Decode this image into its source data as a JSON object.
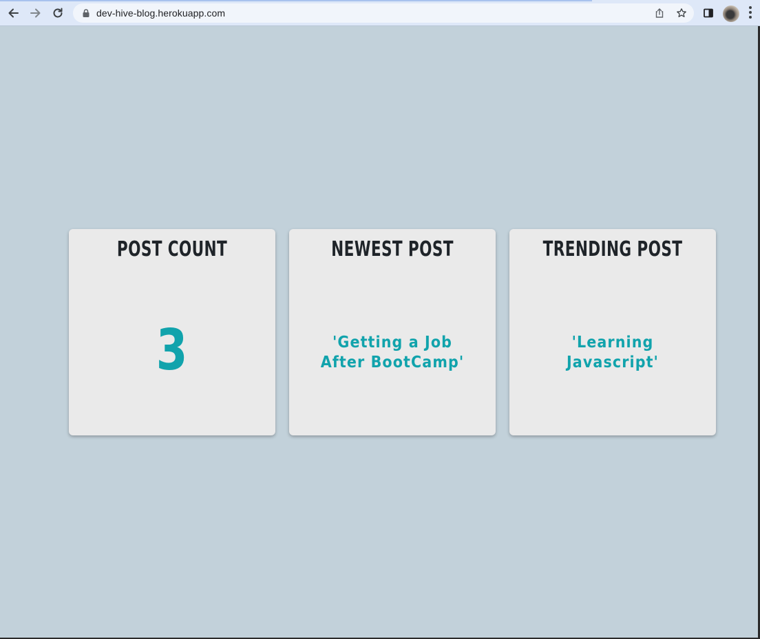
{
  "browser": {
    "url": "dev-hive-blog.herokuapp.com",
    "icons": [
      "back-arrow-icon",
      "forward-arrow-icon",
      "reload-icon",
      "lock-icon",
      "share-icon",
      "bookmark-star-icon",
      "side-panel-icon",
      "profile-avatar",
      "more-menu-icon"
    ]
  },
  "colors": {
    "page_background": "#c2d1da",
    "card_background": "#eaeaea",
    "accent": "#11a3ac",
    "heading": "#1f2429"
  },
  "cards": [
    {
      "title": "Post Count",
      "value": "3"
    },
    {
      "title": "Newest Post",
      "value": "'Getting a Job After BootCamp'"
    },
    {
      "title": "Trending Post",
      "value": "'Learning Javascript'"
    }
  ]
}
